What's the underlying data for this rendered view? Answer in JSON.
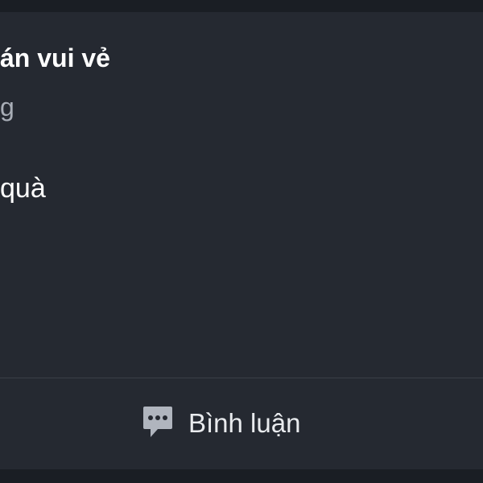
{
  "post": {
    "title": "án vui vẻ",
    "subtitle": "g",
    "body": "quà"
  },
  "actions": {
    "comment_label": "Bình luận",
    "comment_icon": "comment-bubble-icon"
  },
  "colors": {
    "page_background": "#1a1e24",
    "card_background": "#252931",
    "title_text": "#ffffff",
    "subtitle_text": "#a8adb6",
    "divider": "#3a3f47",
    "icon": "#b0b5be"
  }
}
